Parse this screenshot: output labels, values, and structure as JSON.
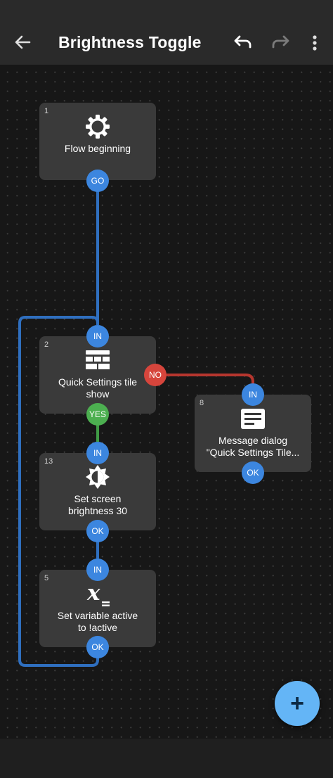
{
  "app_bar": {
    "title": "Brightness Toggle",
    "back_icon": "arrow-back-icon",
    "undo_icon": "undo-icon",
    "redo_icon": "redo-icon",
    "more_icon": "more-vert-icon"
  },
  "colors": {
    "appbar_bg": "#2a2a2a",
    "canvas_bg": "#171717",
    "node_bg": "#3a3a3a",
    "port_blue": "#3c86df",
    "port_red": "#d6453c",
    "port_green": "#4caf50",
    "wire_blue": "#2f6fbf",
    "wire_red": "#b6362e",
    "wire_green": "#3f9a45",
    "fab": "#64b5f6"
  },
  "nodes": [
    {
      "id": "1",
      "label": "Flow beginning",
      "icon": "gear-icon",
      "ports": {
        "out": "GO"
      }
    },
    {
      "id": "2",
      "label": "Quick Settings tile\nshow",
      "icon": "tiles-icon",
      "ports": {
        "in": "IN",
        "no": "NO",
        "yes": "YES"
      }
    },
    {
      "id": "13",
      "label": "Set screen\nbrightness 30",
      "icon": "brightness-icon",
      "ports": {
        "in": "IN",
        "ok": "OK"
      }
    },
    {
      "id": "5",
      "label": "Set variable active\nto !active",
      "icon": "variable-icon",
      "ports": {
        "in": "IN",
        "ok": "OK"
      }
    },
    {
      "id": "8",
      "label": "Message dialog\n\"Quick Settings Tile...",
      "icon": "message-icon",
      "ports": {
        "in": "IN",
        "ok": "OK"
      }
    }
  ],
  "fab": {
    "icon": "add-icon",
    "label": "+"
  }
}
